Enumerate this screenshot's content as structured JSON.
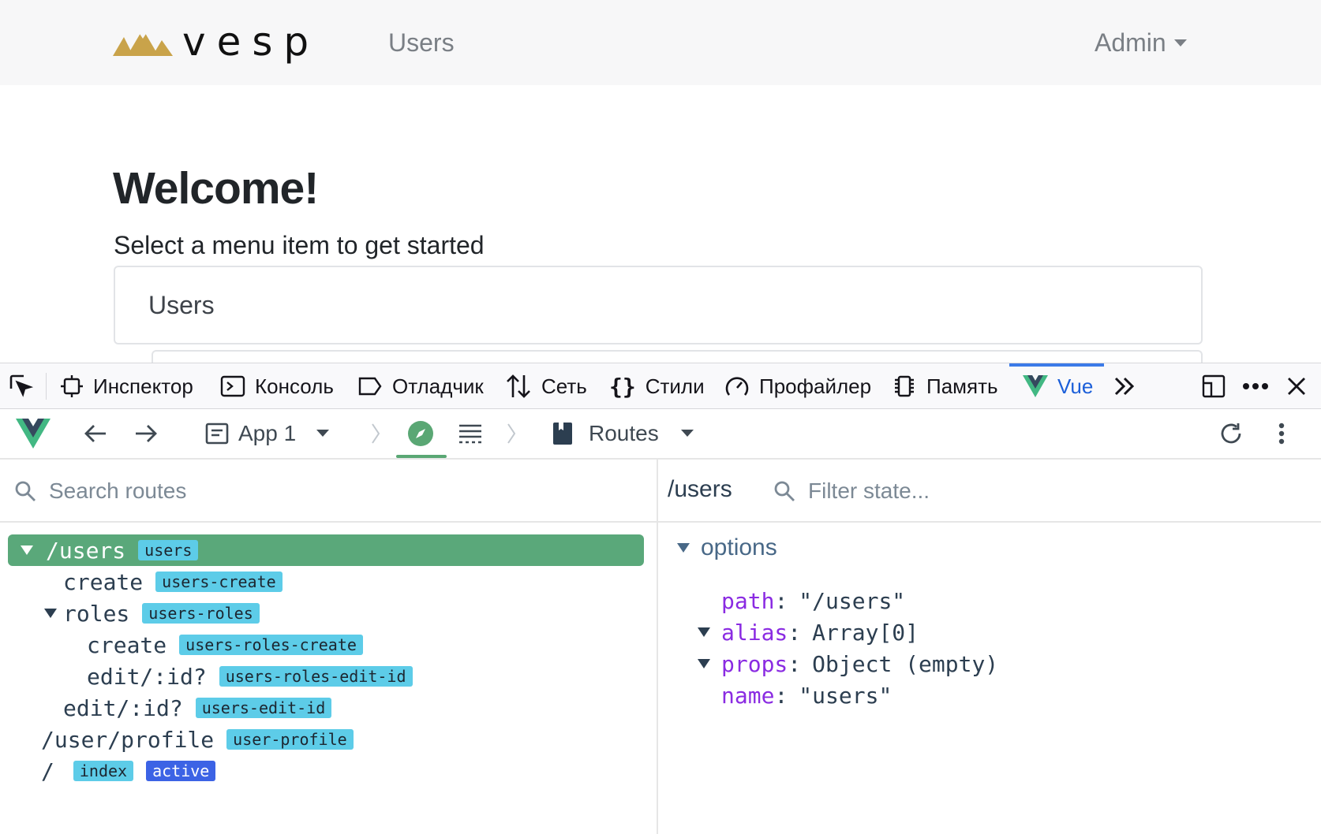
{
  "app": {
    "brand": "vesp",
    "nav_link": "Users",
    "admin": "Admin",
    "welcome": "Welcome!",
    "subtitle": "Select a menu item to get started",
    "card_title": "Users"
  },
  "devtools": {
    "tabs": {
      "inspector": "Инспектор",
      "console": "Консоль",
      "debugger": "Отладчик",
      "network": "Сеть",
      "styles": "Стили",
      "profiler": "Профайлер",
      "memory": "Память",
      "vue": "Vue"
    }
  },
  "vue_header": {
    "app_select": "App 1",
    "routes_select": "Routes"
  },
  "routes_panel": {
    "search_placeholder": "Search routes",
    "routes": [
      {
        "label": "/users",
        "tag": "users"
      },
      {
        "label": "create",
        "tag": "users-create"
      },
      {
        "label": "roles",
        "tag": "users-roles"
      },
      {
        "label": "create",
        "tag": "users-roles-create"
      },
      {
        "label": "edit/:id?",
        "tag": "users-roles-edit-id"
      },
      {
        "label": "edit/:id?",
        "tag": "users-edit-id"
      },
      {
        "label": "/user/profile",
        "tag": "user-profile"
      },
      {
        "label": "/",
        "tag": "index",
        "status": "active"
      }
    ]
  },
  "state_panel": {
    "path": "/users",
    "filter_placeholder": "Filter state...",
    "section": "options",
    "props": [
      {
        "key": "path",
        "value": "\"/users\""
      },
      {
        "key": "alias",
        "value": "Array[0]"
      },
      {
        "key": "props",
        "value": "Object (empty)"
      },
      {
        "key": "name",
        "value": "\"users\""
      }
    ]
  },
  "colors": {
    "selected_row": "#5aa87a",
    "tag_bg": "#5dcce8",
    "active_tag_bg": "#3c63e5",
    "vue_accent": "#1c5fd9",
    "prop_key": "#8a2be2",
    "logo_gold": "#c9a34a"
  }
}
